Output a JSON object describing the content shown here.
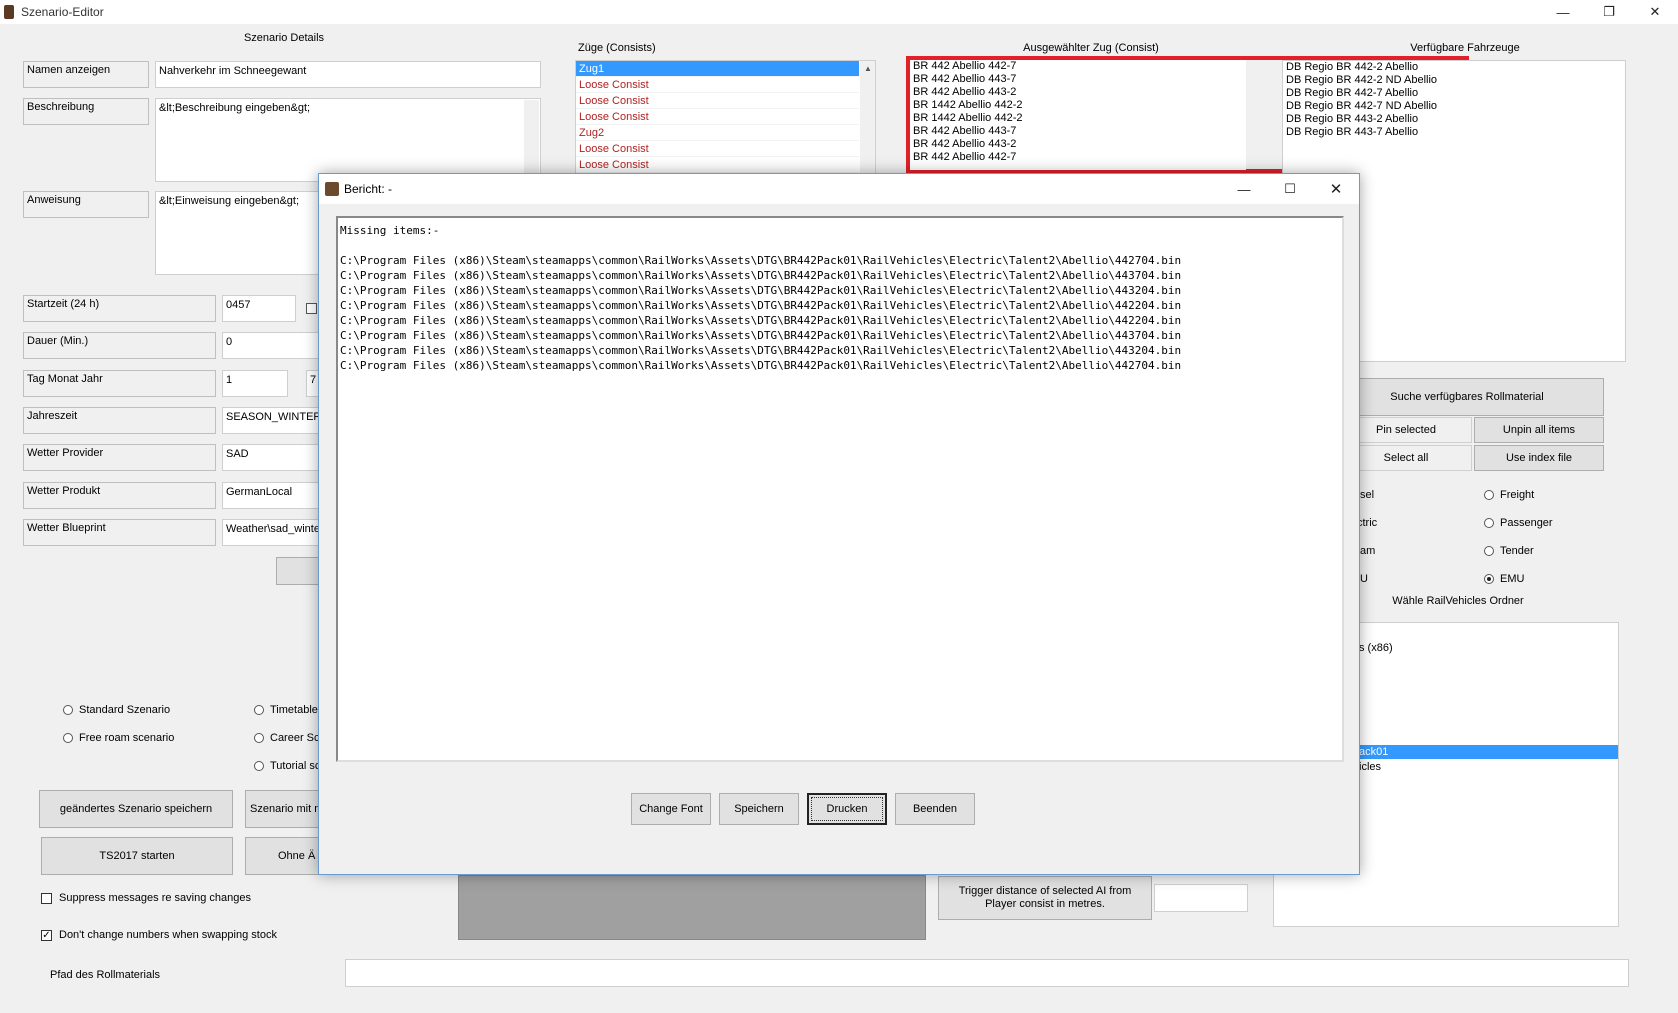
{
  "window": {
    "title": "Szenario-Editor",
    "controls": {
      "minimize": "—",
      "maximize": "❐",
      "close": "✕"
    }
  },
  "details": {
    "section_title": "Szenario Details",
    "fields": [
      {
        "label": "Namen anzeigen",
        "value": "Nahverkehr im Schneegewant"
      },
      {
        "label": "Beschreibung",
        "value": "&lt;Beschreibung eingeben&gt;"
      },
      {
        "label": "Anweisung",
        "value": "&lt;Einweisung eingeben&gt;"
      }
    ],
    "rows": [
      {
        "label": "Startzeit (24 h)",
        "value": "0457"
      },
      {
        "label": "Dauer (Min.)",
        "value": "0"
      },
      {
        "label": "Tag Monat Jahr",
        "value": "1",
        "value2": "7"
      },
      {
        "label": "Jahreszeit",
        "value": "SEASON_WINTER"
      },
      {
        "label": "Wetter Provider",
        "value": "SAD"
      },
      {
        "label": "Wetter Produkt",
        "value": "GermanLocal"
      },
      {
        "label": "Wetter Blueprint",
        "value": "Weather\\sad_winte"
      }
    ]
  },
  "scenario_type": {
    "options": [
      "Standard Szenario",
      "Free roam scenario",
      "Timetable",
      "Career Sc",
      "Tutorial sc"
    ]
  },
  "buttons_left": {
    "save_changed": "geändertes Szenario speichern",
    "save_with": "Szenario mit n",
    "start_ts": "TS2017 starten",
    "without": "Ohne Ä"
  },
  "checkboxes": [
    {
      "label": "Suppress messages re saving changes",
      "checked": false,
      "mark": ""
    },
    {
      "label": "Don't change numbers when swapping stock",
      "checked": true,
      "mark": "✓"
    }
  ],
  "path": {
    "label": "Pfad des Rollmaterials",
    "value": ""
  },
  "consists": {
    "title": "Züge (Consists)",
    "items": [
      "Zug1",
      "Loose Consist",
      "Loose Consist",
      "Loose Consist",
      "Zug2",
      "Loose Consist",
      "Loose Consist"
    ],
    "scroll_up": "▲"
  },
  "selected_consist": {
    "title": "Ausgewählter Zug (Consist)",
    "items": [
      "BR 442 Abellio 442-7",
      "BR 442 Abellio 443-7",
      "BR 442 Abellio 443-2",
      "BR 1442 Abellio 442-2",
      "BR 1442 Abellio 442-2",
      "BR 442 Abellio 443-7",
      "BR 442 Abellio 443-2",
      "BR 442 Abellio 442-7"
    ]
  },
  "available": {
    "title": "Verfügbare Fahrzeuge",
    "items": [
      "DB Regio BR 442-2 Abellio",
      "DB Regio BR 442-2 ND Abellio",
      "DB Regio BR 442-7 Abellio",
      "DB Regio BR 442-7 ND Abellio",
      "DB Regio BR 443-2 Abellio",
      "DB Regio BR 443-7 Abellio"
    ]
  },
  "rolling_stock": {
    "search": "Suche verfügbares Rollmaterial",
    "pin": "Pin selected",
    "unpin": "Unpin all items",
    "select_all": "Select all",
    "use_index": "Use index file",
    "types_left": [
      "sel",
      "ctric",
      "am",
      "U"
    ],
    "types_right": [
      {
        "label": "Freight",
        "checked": false
      },
      {
        "label": "Passenger",
        "checked": false
      },
      {
        "label": "Tender",
        "checked": false
      },
      {
        "label": "EMU",
        "checked": true
      }
    ],
    "folder_title": "Wähle RailVehicles Ordner",
    "folders": [
      "s (x86)",
      "ack01",
      "icles"
    ]
  },
  "trigger": {
    "label": "Trigger distance of selected AI from Player consist in metres.",
    "value": ""
  },
  "dialog": {
    "title": "Bericht: -",
    "controls": {
      "minimize": "—",
      "maximize": "☐",
      "close": "✕"
    },
    "report_header": "Missing items:-",
    "report_lines": [
      "C:\\Program Files (x86)\\Steam\\steamapps\\common\\RailWorks\\Assets\\DTG\\BR442Pack01\\RailVehicles\\Electric\\Talent2\\Abellio\\442704.bin",
      "C:\\Program Files (x86)\\Steam\\steamapps\\common\\RailWorks\\Assets\\DTG\\BR442Pack01\\RailVehicles\\Electric\\Talent2\\Abellio\\443704.bin",
      "C:\\Program Files (x86)\\Steam\\steamapps\\common\\RailWorks\\Assets\\DTG\\BR442Pack01\\RailVehicles\\Electric\\Talent2\\Abellio\\443204.bin",
      "C:\\Program Files (x86)\\Steam\\steamapps\\common\\RailWorks\\Assets\\DTG\\BR442Pack01\\RailVehicles\\Electric\\Talent2\\Abellio\\442204.bin",
      "C:\\Program Files (x86)\\Steam\\steamapps\\common\\RailWorks\\Assets\\DTG\\BR442Pack01\\RailVehicles\\Electric\\Talent2\\Abellio\\442204.bin",
      "C:\\Program Files (x86)\\Steam\\steamapps\\common\\RailWorks\\Assets\\DTG\\BR442Pack01\\RailVehicles\\Electric\\Talent2\\Abellio\\443704.bin",
      "C:\\Program Files (x86)\\Steam\\steamapps\\common\\RailWorks\\Assets\\DTG\\BR442Pack01\\RailVehicles\\Electric\\Talent2\\Abellio\\443204.bin",
      "C:\\Program Files (x86)\\Steam\\steamapps\\common\\RailWorks\\Assets\\DTG\\BR442Pack01\\RailVehicles\\Electric\\Talent2\\Abellio\\442704.bin"
    ],
    "buttons": {
      "change_font": "Change Font",
      "save": "Speichern",
      "print": "Drucken",
      "quit": "Beenden"
    }
  },
  "colors": {
    "highlight": "#3399ff",
    "consist_text": "#b22222",
    "annotation_box": "#e0202a",
    "dark_panel": "#a0a0a0"
  },
  "icons": [
    "app-icon",
    "dialog-app-icon",
    "scroll-up-icon",
    "minimize-icon",
    "maximize-icon",
    "close-icon"
  ]
}
